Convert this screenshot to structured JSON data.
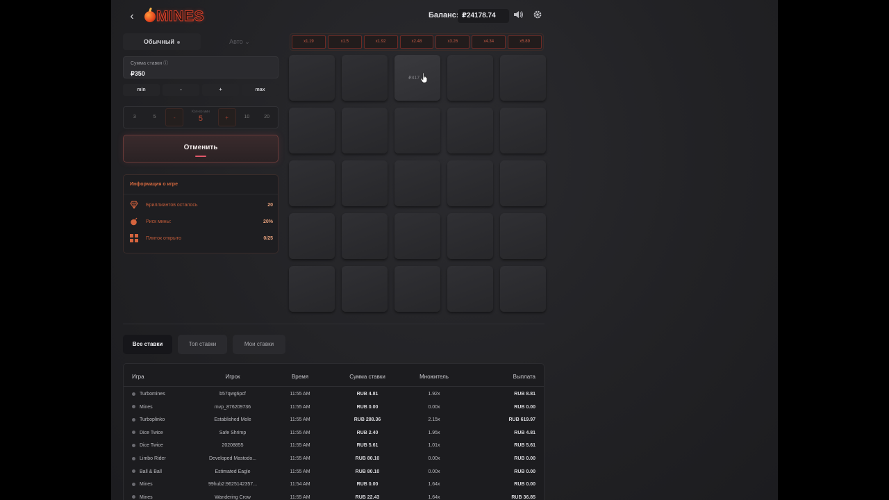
{
  "header": {
    "logo_text": "MINES",
    "balance_label": "Баланс:",
    "balance_value": "₽24178.74"
  },
  "mode_tabs": [
    {
      "label": "Обычный",
      "active": true
    },
    {
      "label": "Авто",
      "active": false
    }
  ],
  "bet": {
    "label": "Сумма ставки ⓘ",
    "value": "₽350"
  },
  "quick_buttons": [
    "min",
    "-",
    "+",
    "max"
  ],
  "mines_selector": {
    "options_left": [
      "3",
      "5"
    ],
    "minus": "-",
    "center_label": "Кол-во мин",
    "center_value": "5",
    "plus": "+",
    "options_right": [
      "10",
      "20"
    ]
  },
  "cancel_label": "Отменить",
  "info": {
    "title": "Информация о игре",
    "rows": [
      {
        "icon": "diamond-icon",
        "label": "Бриллиантов осталось",
        "value": "20"
      },
      {
        "icon": "bomb-icon",
        "label": "Риск мины:",
        "value": "20%"
      },
      {
        "icon": "tiles-icon",
        "label": "Плиток открыто",
        "value": "0/25"
      }
    ]
  },
  "multipliers": [
    "x1.19",
    "x1.5",
    "x1.92",
    "x2.48",
    "x3.26",
    "x4.34",
    "x5.89"
  ],
  "grid": {
    "rows": 5,
    "cols": 5,
    "hover_tile_index": 2,
    "hover_text": "₽417"
  },
  "bet_tabs": [
    "Все ставки",
    "Топ ставки",
    "Мои ставки"
  ],
  "table": {
    "headers": [
      "Игра",
      "Игрок",
      "Время",
      "Сумма ставки",
      "Множитель",
      "Выплата"
    ],
    "rows": [
      [
        "Turbomines",
        "b57qwg6pcf",
        "11:55 AM",
        "RUB 4.81",
        "1.92x",
        "RUB 8.81"
      ],
      [
        "Mines",
        "mvp_876209736",
        "11:55 AM",
        "RUB 0.00",
        "0.00x",
        "RUB 0.00"
      ],
      [
        "Turboplinko",
        "Established Mole",
        "11:55 AM",
        "RUB 288.36",
        "2.15x",
        "RUB 619.97"
      ],
      [
        "Dice Twice",
        "Safe Shrimp",
        "11:55 AM",
        "RUB 2.40",
        "1.95x",
        "RUB 4.81"
      ],
      [
        "Dice Twice",
        "20208855",
        "11:55 AM",
        "RUB 5.61",
        "1.01x",
        "RUB 5.61"
      ],
      [
        "Limbo Rider",
        "Developed Mastodo...",
        "11:55 AM",
        "RUB 80.10",
        "0.00x",
        "RUB 0.00"
      ],
      [
        "Ball & Ball",
        "Estimated Eagle",
        "11:55 AM",
        "RUB 80.10",
        "0.00x",
        "RUB 0.00"
      ],
      [
        "Mines",
        "99hub2:9625142357...",
        "11:54 AM",
        "RUB 0.00",
        "1.64x",
        "RUB 0.00"
      ],
      [
        "Mines",
        "Wandering Crow",
        "11:55 AM",
        "RUB 22.43",
        "1.64x",
        "RUB 36.85"
      ]
    ]
  }
}
